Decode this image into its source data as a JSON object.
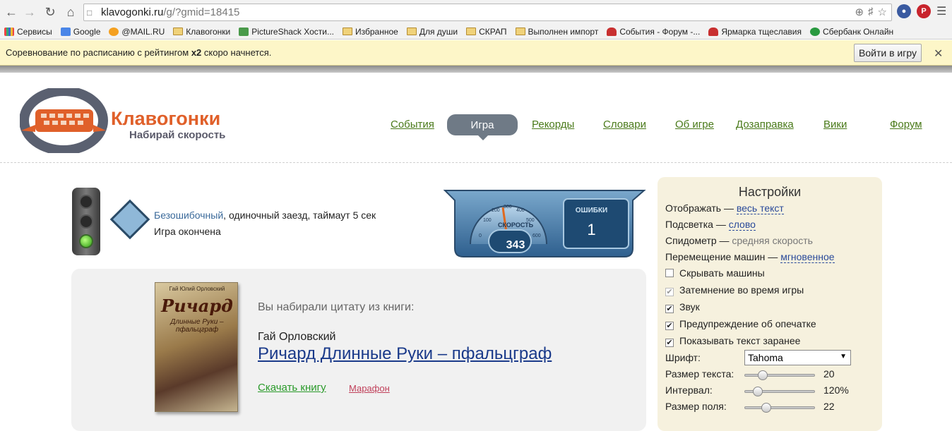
{
  "browser": {
    "url_host": "klavogonki.ru",
    "url_path": "/g/?gmid=18415",
    "bookmarks": [
      {
        "label": "Сервисы",
        "icon": "apps-grid-icon"
      },
      {
        "label": "Google",
        "icon": "google-icon"
      },
      {
        "label": "@MAIL.RU",
        "icon": "mailru-icon"
      },
      {
        "label": "Клавогонки",
        "icon": "folder-icon"
      },
      {
        "label": "PictureShack Хости...",
        "icon": "pictureshack-icon"
      },
      {
        "label": "Избранное",
        "icon": "folder-icon"
      },
      {
        "label": "Для души",
        "icon": "folder-icon"
      },
      {
        "label": "СКРАП",
        "icon": "folder-icon"
      },
      {
        "label": "Выполнен импорт",
        "icon": "folder-icon"
      },
      {
        "label": "События - Форум -...",
        "icon": "car-icon"
      },
      {
        "label": "Ярмарка тщеславия",
        "icon": "car-icon"
      },
      {
        "label": "Сбербанк Онлайн",
        "icon": "sberbank-icon"
      }
    ],
    "notification": {
      "text_before": "Соревнование по расписанию с рейтингом ",
      "text_bold": "x2",
      "text_after": " скоро начнется.",
      "button": "Войти в игру"
    }
  },
  "site": {
    "logo_title": "Клавогонки",
    "logo_subtitle": "Набирай скорость",
    "menu": {
      "events": "События",
      "game": "Игра",
      "records": "Рекорды",
      "dictionaries": "Словари",
      "about": "Об игре",
      "refuel": "Дозаправка",
      "wiki": "Вики",
      "forum": "Форум"
    }
  },
  "race": {
    "mode_link": "Безошибочный",
    "mode_rest": ", одиночный заезд, таймаут 5 сек",
    "status": "Игра окончена",
    "speed_label": "СКОРОСТЬ",
    "speed": "343",
    "errors_label": "ОШИБКИ",
    "errors": "1",
    "dial_ticks": [
      "0",
      "100",
      "200",
      "300",
      "400",
      "500",
      "600"
    ]
  },
  "book": {
    "intro": "Вы набирали цитату из книги:",
    "author": "Гай Орловский",
    "title": "Ричард Длинные Руки – пфальцграф",
    "download": "Скачать книгу",
    "marathon": "Марафон",
    "cover_author": "Гай Юлий Орловский",
    "cover_title": "Ричард",
    "cover_subtitle": "Длинные Руки – пфальцграф"
  },
  "settings": {
    "title": "Настройки",
    "display_label": "Отображать — ",
    "display_value": "весь текст",
    "highlight_label": "Подсветка — ",
    "highlight_value": "слово",
    "speedometer_label": "Спидометр — ",
    "speedometer_value": "средняя скорость",
    "cars_move_label": "Перемещение машин — ",
    "cars_move_value": "мгновенное",
    "checkboxes": [
      {
        "label": "Скрывать машины",
        "checked": false,
        "disabled": false
      },
      {
        "label": "Затемнение во время игры",
        "checked": true,
        "disabled": true
      },
      {
        "label": "Звук",
        "checked": true,
        "disabled": false
      },
      {
        "label": "Предупреждение об опечатке",
        "checked": true,
        "disabled": false
      },
      {
        "label": "Показывать текст заранее",
        "checked": true,
        "disabled": false
      }
    ],
    "font_label": "Шрифт:",
    "font_value": "Tahoma",
    "sliders": [
      {
        "label": "Размер текста:",
        "value": "20",
        "level": 0.25
      },
      {
        "label": "Интервал:",
        "value": "120%",
        "level": 0.18
      },
      {
        "label": "Размер поля:",
        "value": "22",
        "level": 0.3
      }
    ]
  },
  "colors": {
    "accent_orange": "#e0602a",
    "menu_green": "#4a7a1a",
    "active_menu": "#6f7a86",
    "settings_bg": "#f6f1de"
  }
}
